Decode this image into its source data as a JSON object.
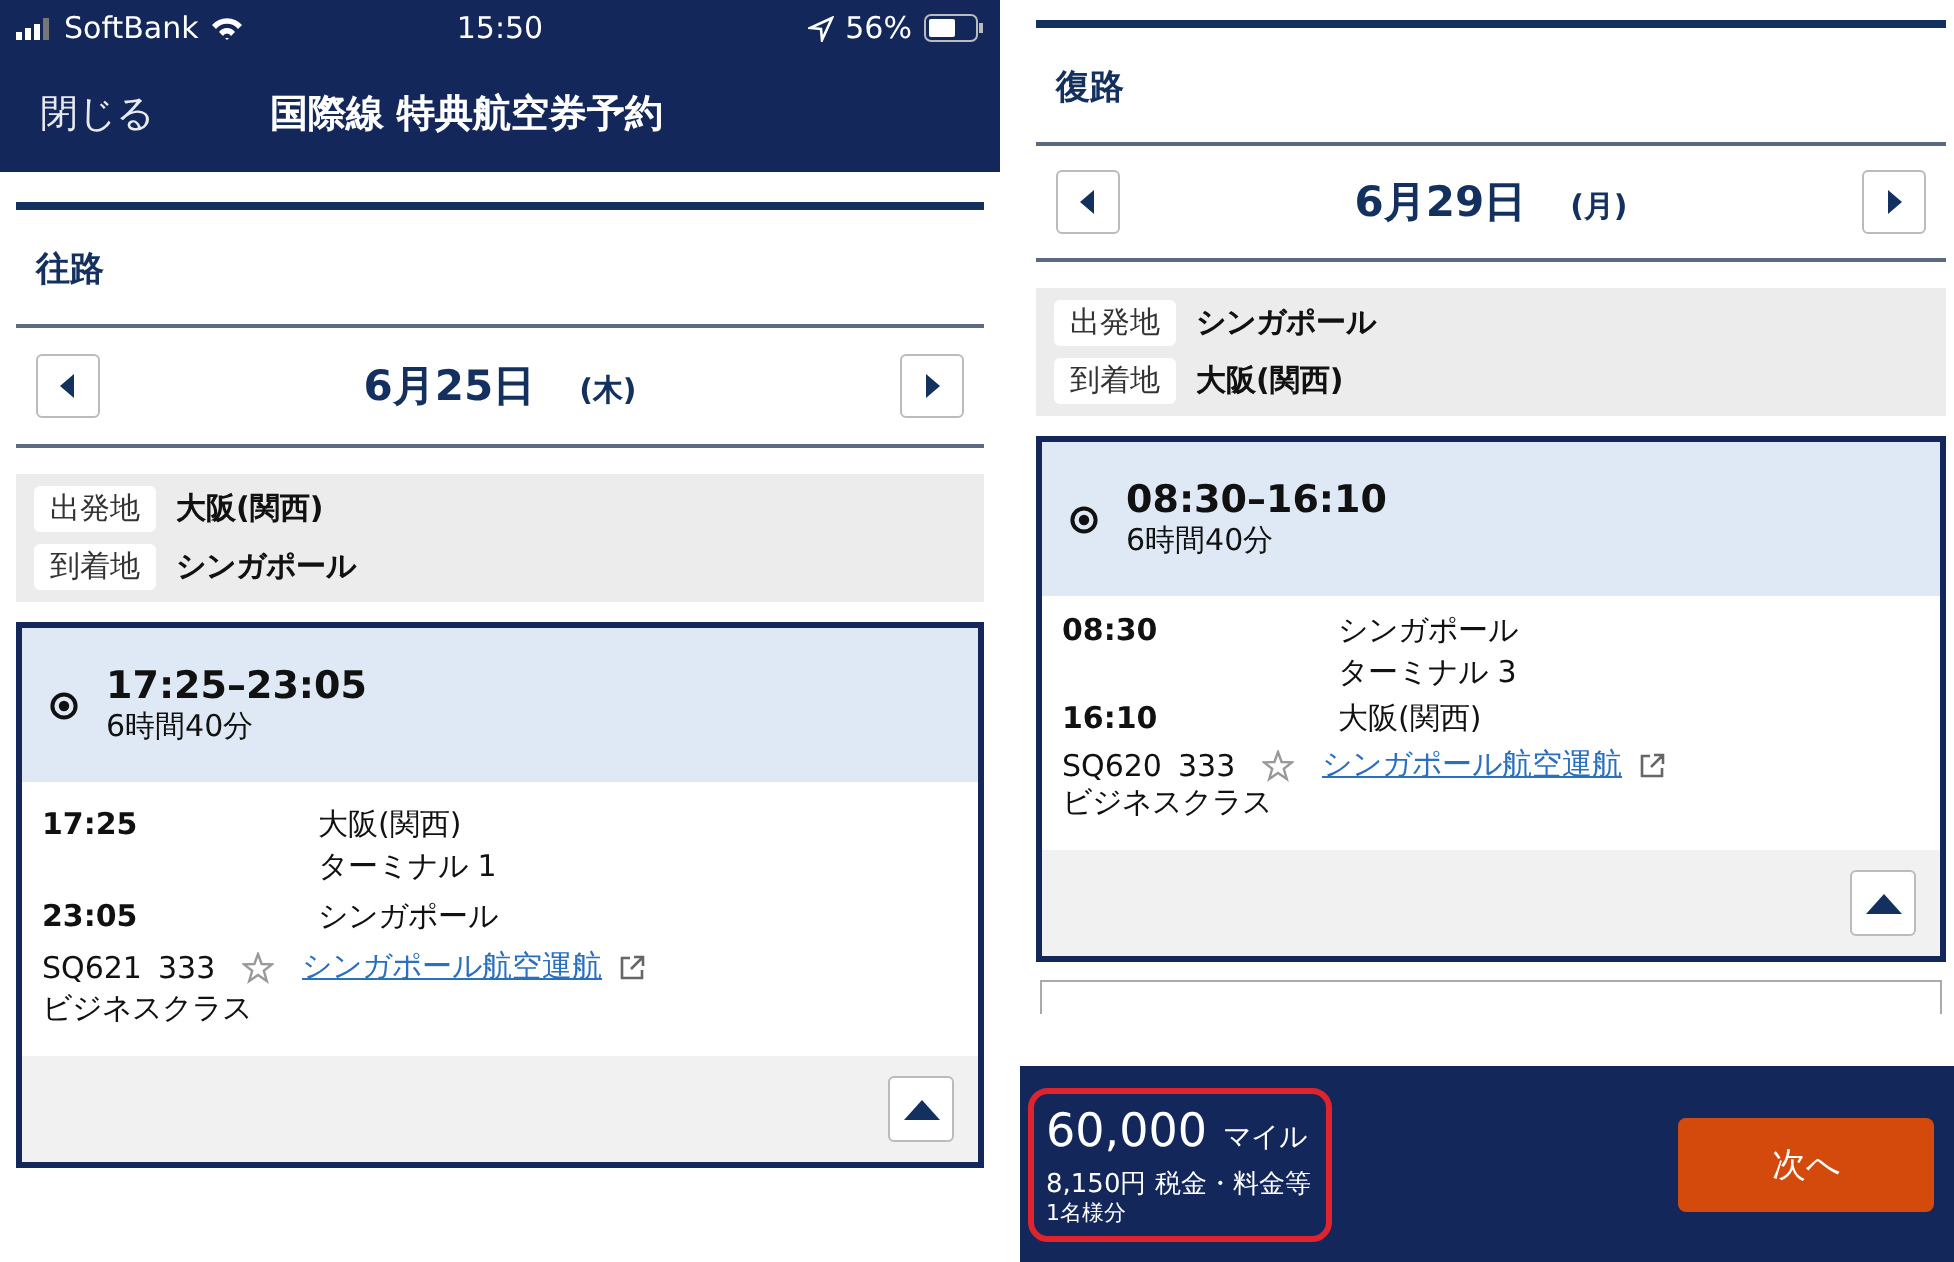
{
  "screens": [
    {
      "status_bar": {
        "carrier": "SoftBank",
        "time": "15:50",
        "battery": "56%"
      },
      "nav": {
        "close": "閉じる",
        "title": "国際線 特典航空券予約"
      },
      "segment": {
        "heading": "往路",
        "date": "6月25日",
        "weekday": "(木)",
        "places": [
          {
            "label": "出発地",
            "value": "大阪(関西)"
          },
          {
            "label": "到着地",
            "value": "シンガポール"
          }
        ],
        "flight": {
          "selected": true,
          "time_range": "17:25–23:05",
          "duration": "6時間40分",
          "stops": [
            {
              "time": "17:25",
              "place": "大阪(関西)",
              "terminal": "ターミナル 1"
            },
            {
              "time": "23:05",
              "place": "シンガポール"
            }
          ],
          "flight_no": "SQ621",
          "aircraft": "333",
          "carrier_link": "シンガポール航空運航",
          "cabin": "ビジネスクラス"
        }
      }
    },
    {
      "segment": {
        "heading": "復路",
        "date": "6月29日",
        "weekday": "(月)",
        "places": [
          {
            "label": "出発地",
            "value": "シンガポール"
          },
          {
            "label": "到着地",
            "value": "大阪(関西)"
          }
        ],
        "flight": {
          "selected": true,
          "time_range": "08:30–16:10",
          "duration": "6時間40分",
          "stops": [
            {
              "time": "08:30",
              "place": "シンガポール",
              "terminal": "ターミナル 3"
            },
            {
              "time": "16:10",
              "place": "大阪(関西)"
            }
          ],
          "flight_no": "SQ620",
          "aircraft": "333",
          "carrier_link": "シンガポール航空運航",
          "cabin": "ビジネスクラス"
        }
      },
      "footer": {
        "miles": "60,000",
        "miles_unit": "マイル",
        "taxes": "8,150円 税金・料金等",
        "per_person": "1名様分",
        "next_button": "次へ",
        "highlighted": true
      }
    }
  ]
}
